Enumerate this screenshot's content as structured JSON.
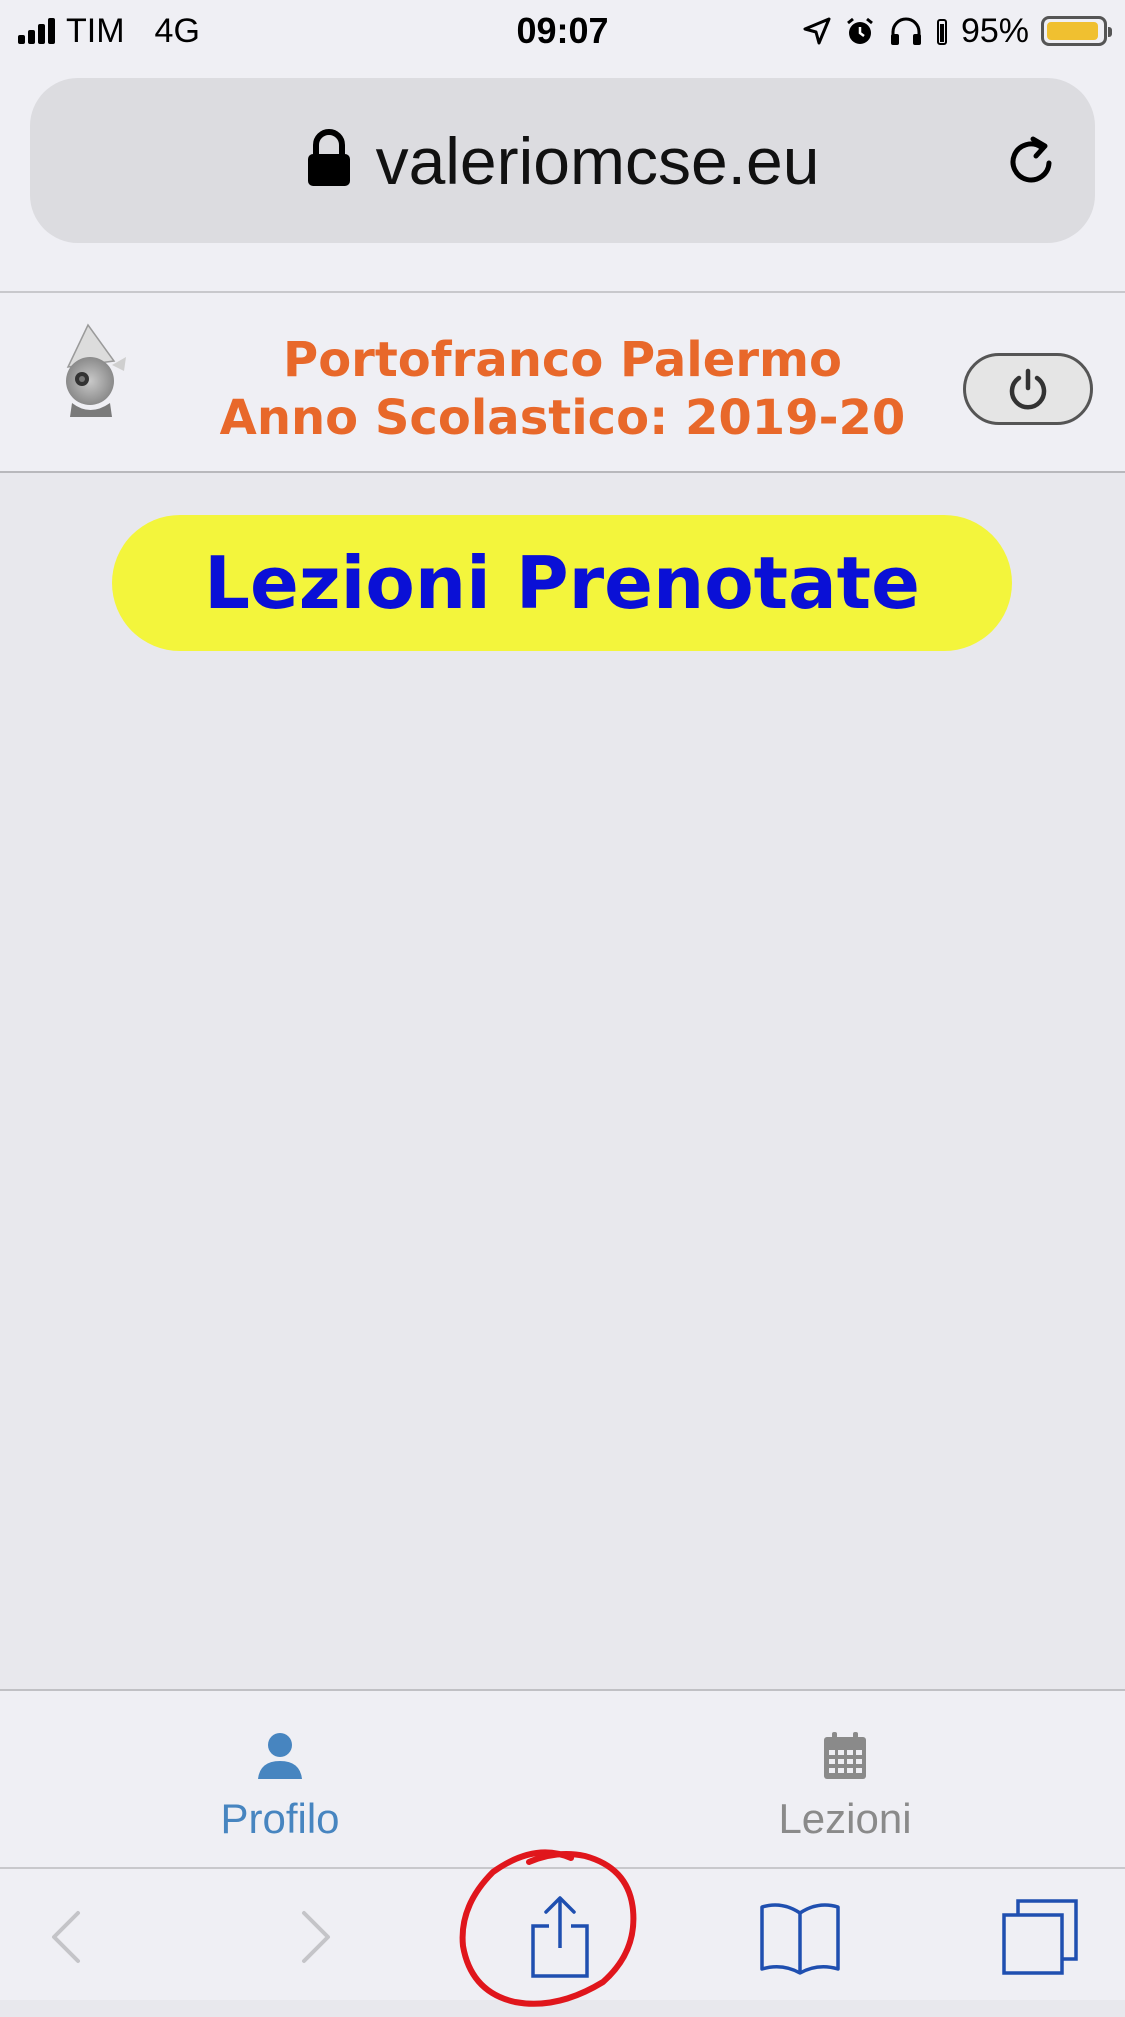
{
  "status_bar": {
    "carrier": "TIM",
    "network": "4G",
    "time": "09:07",
    "battery": "95%",
    "battery_level": 0.95,
    "icons": [
      "signal-icon",
      "location-arrow-icon",
      "alarm-icon",
      "headphones-icon",
      "battery-icon"
    ]
  },
  "browser": {
    "url": "valeriomcse.eu",
    "lock_icon": "lock-icon",
    "reload_icon": "reload-icon"
  },
  "header": {
    "org_name": "Portofranco Palermo",
    "school_year": "Anno Scolastico: 2019-20",
    "avatar_icon": "avatar-image",
    "power_icon": "power-icon"
  },
  "main": {
    "title": "Lezioni Prenotate"
  },
  "tabs": [
    {
      "label": "Profilo",
      "icon": "user-icon",
      "active": true,
      "color": "#4785c0"
    },
    {
      "label": "Lezioni",
      "icon": "calendar-icon",
      "active": false,
      "color": "#8a8a8a"
    }
  ],
  "toolbar": {
    "icons": [
      "back-icon",
      "forward-icon",
      "share-icon",
      "bookmarks-icon",
      "tabs-icon"
    ],
    "accent_color": "#1f4fb0",
    "annotation_color": "#e0161c"
  },
  "colors": {
    "header_text": "#e8682a",
    "title_text": "#0a10d6",
    "title_bg": "#f3f53c"
  }
}
